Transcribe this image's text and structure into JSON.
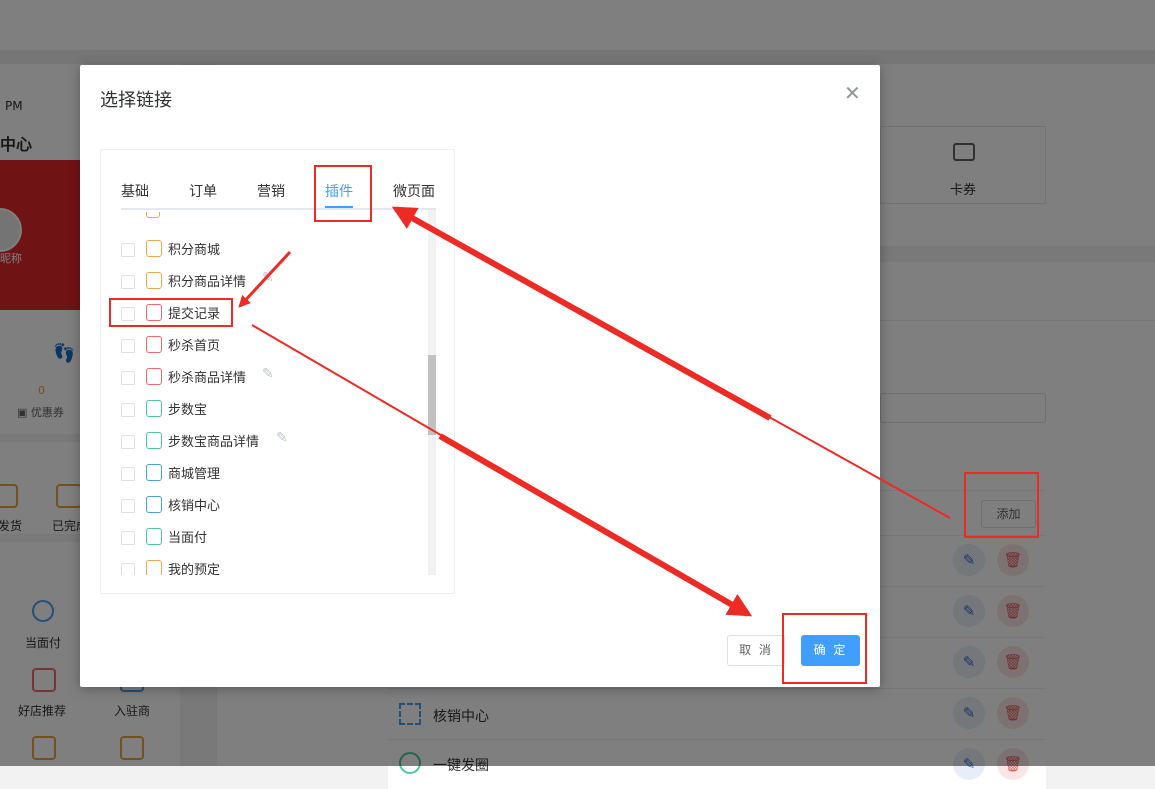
{
  "background": {
    "phone": {
      "time": "PM",
      "title": "中心",
      "nickname": "昵称",
      "coupon_count": "0",
      "coupon_label": "优惠券",
      "order_labels": [
        "发货",
        "已完成"
      ],
      "grid_labels": [
        "当面付",
        "好店推荐",
        "入驻商"
      ]
    },
    "card_label": "卡券",
    "add_button": "添加",
    "rows": [
      "核销中心",
      "一键发圈"
    ]
  },
  "dialog": {
    "title": "选择链接",
    "tabs": [
      {
        "label": "基础",
        "active": false
      },
      {
        "label": "订单",
        "active": false
      },
      {
        "label": "营销",
        "active": false
      },
      {
        "label": "插件",
        "active": true
      },
      {
        "label": "微页面",
        "active": false
      }
    ],
    "items": [
      {
        "label": "积分商城",
        "icon": "integral-mall-icon",
        "color": "#f0a752",
        "editable": false
      },
      {
        "label": "积分商品详情",
        "icon": "integral-goods-icon",
        "color": "#f0a752",
        "editable": true
      },
      {
        "label": "提交记录",
        "icon": "submit-record-icon",
        "color": "#ef6a6a",
        "editable": false
      },
      {
        "label": "秒杀首页",
        "icon": "alarm-clock-icon",
        "color": "#ef6a6a",
        "editable": false
      },
      {
        "label": "秒杀商品详情",
        "icon": "alarm-clock-icon",
        "color": "#ef6a6a",
        "editable": true
      },
      {
        "label": "步数宝",
        "icon": "footprint-icon",
        "color": "#4cc8a0",
        "editable": false
      },
      {
        "label": "步数宝商品详情",
        "icon": "footprint-icon",
        "color": "#4cc8a0",
        "editable": true
      },
      {
        "label": "商城管理",
        "icon": "mall-manage-icon",
        "color": "#4a9fe8",
        "editable": false
      },
      {
        "label": "核销中心",
        "icon": "verify-center-icon",
        "color": "#4a9fe8",
        "editable": false
      },
      {
        "label": "当面付",
        "icon": "scan-pay-icon",
        "color": "#4cc8a0",
        "editable": false
      },
      {
        "label": "我的预定",
        "icon": "reservation-icon",
        "color": "#f0a752",
        "editable": false
      }
    ],
    "cancel_label": "取 消",
    "confirm_label": "确 定"
  },
  "colors": {
    "primary": "#409eff",
    "annotation": "#ee2a24"
  }
}
